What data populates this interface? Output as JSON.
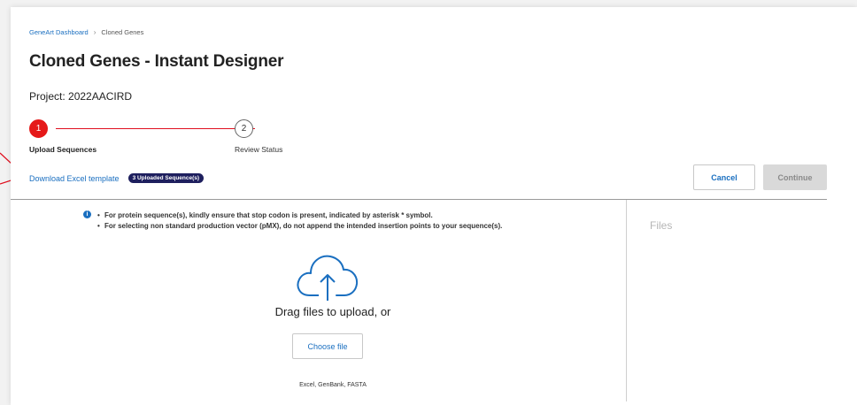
{
  "breadcrumb": {
    "root": "GeneArt Dashboard",
    "separator": "›",
    "current": "Cloned Genes"
  },
  "page": {
    "title": "Cloned Genes - Instant Designer",
    "project": "Project: 2022AACIRD"
  },
  "stepper": {
    "steps": [
      {
        "number": "1",
        "label": "Upload Sequences",
        "active": true
      },
      {
        "number": "2",
        "label": "Review Status",
        "active": false
      }
    ]
  },
  "toolbar": {
    "download_label": "Download Excel template",
    "badge_label": "3 Uploaded Sequence(s)",
    "cancel_label": "Cancel",
    "continue_label": "Continue"
  },
  "upload": {
    "info_icon": "i",
    "notes": [
      "For protein sequence(s), kindly ensure that stop codon is present, indicated by asterisk * symbol.",
      "For selecting non standard production vector (pMX), do not append the intended insertion points to your sequence(s)."
    ],
    "drag_text": "Drag files to upload, or",
    "choose_label": "Choose file",
    "formats": "Excel, GenBank, FASTA",
    "icon": "cloud-upload-icon"
  },
  "files_panel": {
    "title": "Files"
  },
  "colors": {
    "accent": "#1a6fc0",
    "step_active": "#e51919",
    "badge_bg": "#1e1f5e",
    "callout": "#e0101f"
  }
}
